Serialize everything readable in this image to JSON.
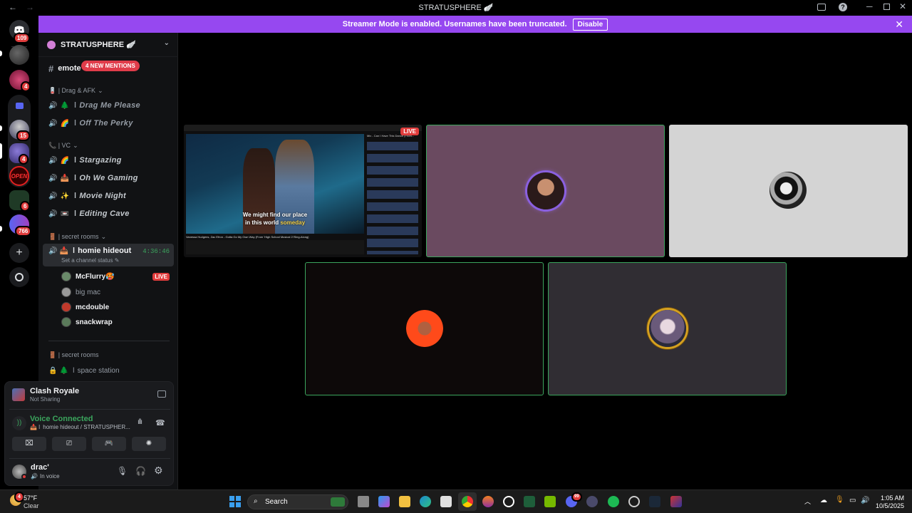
{
  "window": {
    "title": "STRATUSPHERE 🪽",
    "nav_back": "←",
    "nav_forward": "→"
  },
  "banner": {
    "text": "Streamer Mode is enabled. Usernames have been truncated.",
    "button": "Disable",
    "close": "✕"
  },
  "rail": {
    "home_badge": "109",
    "servers": [
      {
        "badge": ""
      },
      {
        "badge": "4"
      },
      {
        "badge": ""
      },
      {
        "badge": "15"
      },
      {
        "badge": "4"
      },
      {
        "badge": ""
      },
      {
        "badge": "6"
      },
      {
        "badge": "766"
      }
    ]
  },
  "server": {
    "name": "STRATUSPHERE 🪽",
    "top_channel": "emote",
    "mentions_pill": "4 NEW MENTIONS",
    "categories": [
      {
        "label": "🪫 | Drag & AFK",
        "channels": [
          "Drag Me Please",
          "Off The Perky"
        ],
        "emojis": [
          "🌲",
          "🌈"
        ]
      },
      {
        "label": "📞 | VC",
        "channels": [
          "Stargazing",
          "Oh We Gaming",
          "Movie Night",
          "Editing Cave"
        ],
        "emojis": [
          "🌈",
          "📥",
          "✨",
          "📼"
        ]
      },
      {
        "label": "🚪 | secret rooms"
      }
    ],
    "active_channel": {
      "name": "homie hideout",
      "timer": "4:36:46",
      "status_placeholder": "Set a channel status ✎"
    },
    "members": [
      {
        "name": "McFlurry🥵",
        "live": "LIVE",
        "color": "#6a8a6a"
      },
      {
        "name": "big mac",
        "live": "",
        "color": "#888"
      },
      {
        "name": "mcdouble",
        "live": "",
        "color": "#c0392b"
      },
      {
        "name": "snackwrap",
        "live": "",
        "color": "#5a7a5a"
      }
    ],
    "category2": "🚪 | secret rooms",
    "locked_channel": "space station"
  },
  "panel": {
    "activity_title": "Clash Royale",
    "activity_sub": "Not Sharing",
    "voice_status": "Voice Connected",
    "voice_channel": "homie hideout / STRATUSPHER...",
    "user_name": "drac'",
    "user_status": "In voice"
  },
  "stage": {
    "live_label": "LIVE",
    "subtitle_line1": "We might find our place",
    "subtitle_line2a": "in this world ",
    "subtitle_line2b": "someday",
    "video_title": "Vanessa Hudgens, Zac Efron - Gotta Go My Own Way (From 'High School Musical 2'/Sing-Along)",
    "sidebar_title": "Mix - Can I Have This Dance (From..."
  },
  "taskbar": {
    "weather_temp": "57°F",
    "weather_cond": "Clear",
    "weather_badge": "4",
    "search": "Search",
    "time": "1:05 AM",
    "date": "10/5/2025",
    "discord_badge": "99"
  },
  "colors": {
    "accent": "#9648f0",
    "voice_green": "#3ba55d",
    "live_red": "#e03c3c"
  }
}
